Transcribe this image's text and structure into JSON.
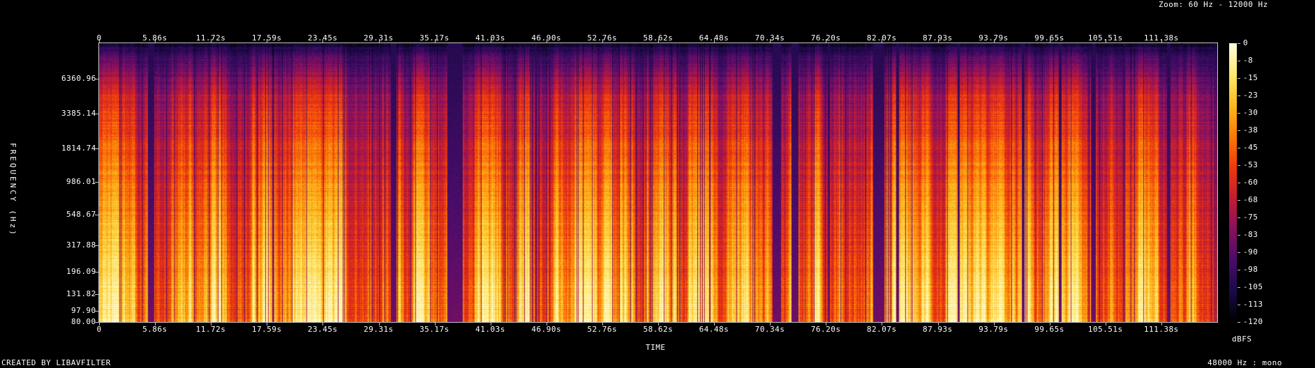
{
  "header": {
    "zoom": "Zoom: 60 Hz - 12000 Hz"
  },
  "footer": {
    "left": "CREATED BY LIBAVFILTER",
    "right": "48000 Hz : mono"
  },
  "chart_data": {
    "type": "heatmap",
    "title": "",
    "xlabel": "TIME",
    "ylabel": "FREQUENCY (Hz)",
    "colorbar_label": "dBFS",
    "x_ticks": [
      "0",
      "5.86s",
      "11.72s",
      "17.59s",
      "23.45s",
      "29.31s",
      "35.17s",
      "41.03s",
      "46.90s",
      "52.76s",
      "58.62s",
      "64.48s",
      "70.34s",
      "76.20s",
      "82.07s",
      "87.93s",
      "93.79s",
      "99.65s",
      "105.51s",
      "111.38s"
    ],
    "x_tick_values": [
      0,
      5.86,
      11.72,
      17.59,
      23.45,
      29.31,
      35.17,
      41.03,
      46.9,
      52.76,
      58.62,
      64.48,
      70.34,
      76.2,
      82.07,
      87.93,
      93.79,
      99.65,
      105.51,
      111.38
    ],
    "xlim": [
      0,
      117.24
    ],
    "y_ticks": [
      "6360.96",
      "3385.14",
      "1814.74",
      "986.01",
      "548.67",
      "317.88",
      "196.09",
      "131.82",
      "97.90",
      "80.00"
    ],
    "ylim": [
      80,
      12000
    ],
    "y_scale": "log",
    "colorbar_ticks": [
      "0",
      "-8",
      "-15",
      "-23",
      "-30",
      "-38",
      "-45",
      "-53",
      "-60",
      "-68",
      "-75",
      "-83",
      "-90",
      "-98",
      "-105",
      "-113",
      "-120"
    ],
    "colorbar_range": [
      -120,
      0
    ],
    "colormap": [
      "#000000",
      "#1c0a4a",
      "#4a0c6a",
      "#8a1060",
      "#c41c30",
      "#ee3a0c",
      "#fb7a08",
      "#fcba1c",
      "#fde870",
      "#fffbe0"
    ]
  }
}
